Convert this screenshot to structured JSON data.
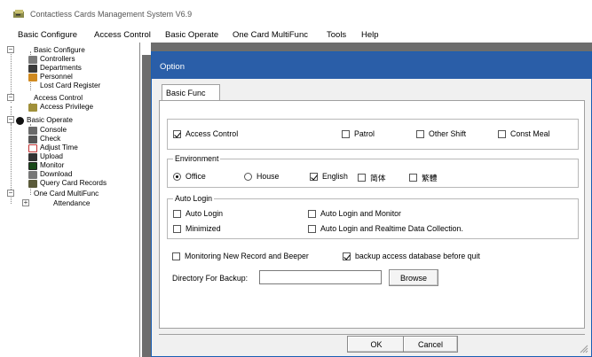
{
  "window": {
    "title": "Contactless Cards Management System  V6.9",
    "icon": "card-reader-icon"
  },
  "menu": [
    {
      "label": "Basic Configure"
    },
    {
      "label": "Access Control"
    },
    {
      "label": "Basic Operate"
    },
    {
      "label": "One Card MultiFunc"
    },
    {
      "label": "Tools"
    },
    {
      "label": "Help"
    }
  ],
  "tree": {
    "basic_configure": "Basic Configure",
    "controllers": "Controllers",
    "departments": "Departments",
    "personnel": "Personnel",
    "lost_card_register": "Lost Card Register",
    "access_control": "Access Control",
    "access_privilege": "Access Privilege",
    "basic_operate": "Basic Operate",
    "console": "Console",
    "check": "Check",
    "adjust_time": "Adjust Time",
    "upload": "Upload",
    "monitor": "Monitor",
    "download": "Download",
    "query_card_records": "Query Card Records",
    "one_card_multifunc": "One Card MultiFunc",
    "attendance": "Attendance"
  },
  "dialog": {
    "title": "Option",
    "tab": "Basic Func",
    "features": {
      "access_control": {
        "label": "Access Control",
        "checked": true
      },
      "patrol": {
        "label": "Patrol",
        "checked": false
      },
      "other_shift": {
        "label": "Other Shift",
        "checked": false
      },
      "const_meal": {
        "label": "Const Meal",
        "checked": false
      }
    },
    "environment": {
      "group_label": "Environment",
      "office": {
        "label": "Office",
        "selected": true
      },
      "house": {
        "label": "House",
        "selected": false
      },
      "english": {
        "label": "English",
        "checked": true
      },
      "simplified": {
        "label": "简体",
        "checked": false
      },
      "traditional": {
        "label": "繁體",
        "checked": false
      }
    },
    "auto_login": {
      "group_label": "Auto Login",
      "auto_login": {
        "label": "Auto Login",
        "checked": false
      },
      "minimized": {
        "label": "Minimized",
        "checked": false
      },
      "auto_login_monitor": {
        "label": "Auto Login and Monitor",
        "checked": false
      },
      "auto_login_realtime": {
        "label": "Auto Login and Realtime Data Collection.",
        "checked": false
      }
    },
    "monitoring_beeper": {
      "label": "Monitoring New Record and Beeper",
      "checked": false
    },
    "backup_before_quit": {
      "label": "backup access database before quit",
      "checked": true
    },
    "backup_dir": {
      "label": "Directory For Backup:",
      "value": ""
    },
    "browse_label": "Browse",
    "ok_label": "OK",
    "cancel_label": "Cancel"
  },
  "colors": {
    "dialog_title_bg": "#2a5ea8",
    "mdi_bg": "#6d6d6d"
  }
}
